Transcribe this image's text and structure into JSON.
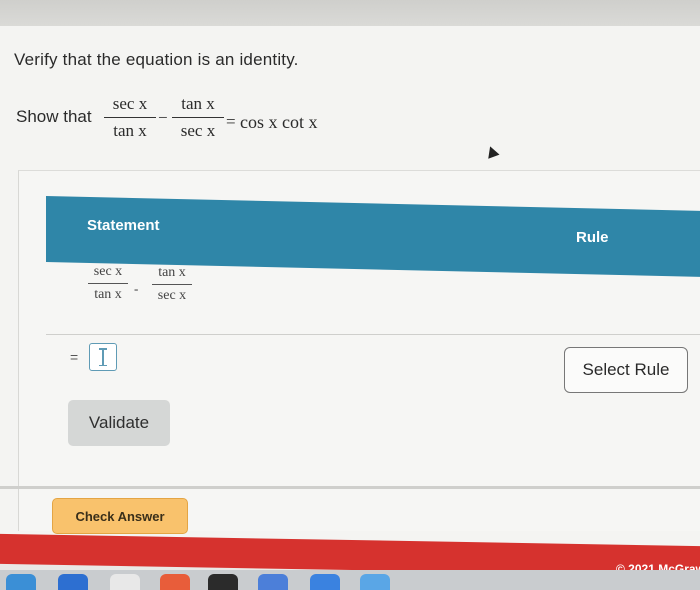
{
  "problem": {
    "prompt": "Verify that the equation is an identity.",
    "show_that": "Show that",
    "lhs_first_num": "sec x",
    "lhs_first_den": "tan x",
    "minus": "−",
    "lhs_second_num": "tan x",
    "lhs_second_den": "sec x",
    "equals": "=",
    "rhs": "cos x cot x"
  },
  "table": {
    "statement_header": "Statement",
    "rule_header": "Rule",
    "row1": {
      "first_num": "sec x",
      "first_den": "tan x",
      "minus": "-",
      "second_num": "tan x",
      "second_den": "sec x"
    },
    "row2": {
      "equals": "=",
      "select_rule_label": "Select Rule"
    },
    "validate_label": "Validate"
  },
  "footer": {
    "check_answer_label": "Check Answer",
    "copyright": "© 2021 McGraw"
  },
  "colors": {
    "header_blue": "#2f86a8",
    "check_answer": "#f9c26c",
    "footer_red": "#d6322e"
  }
}
